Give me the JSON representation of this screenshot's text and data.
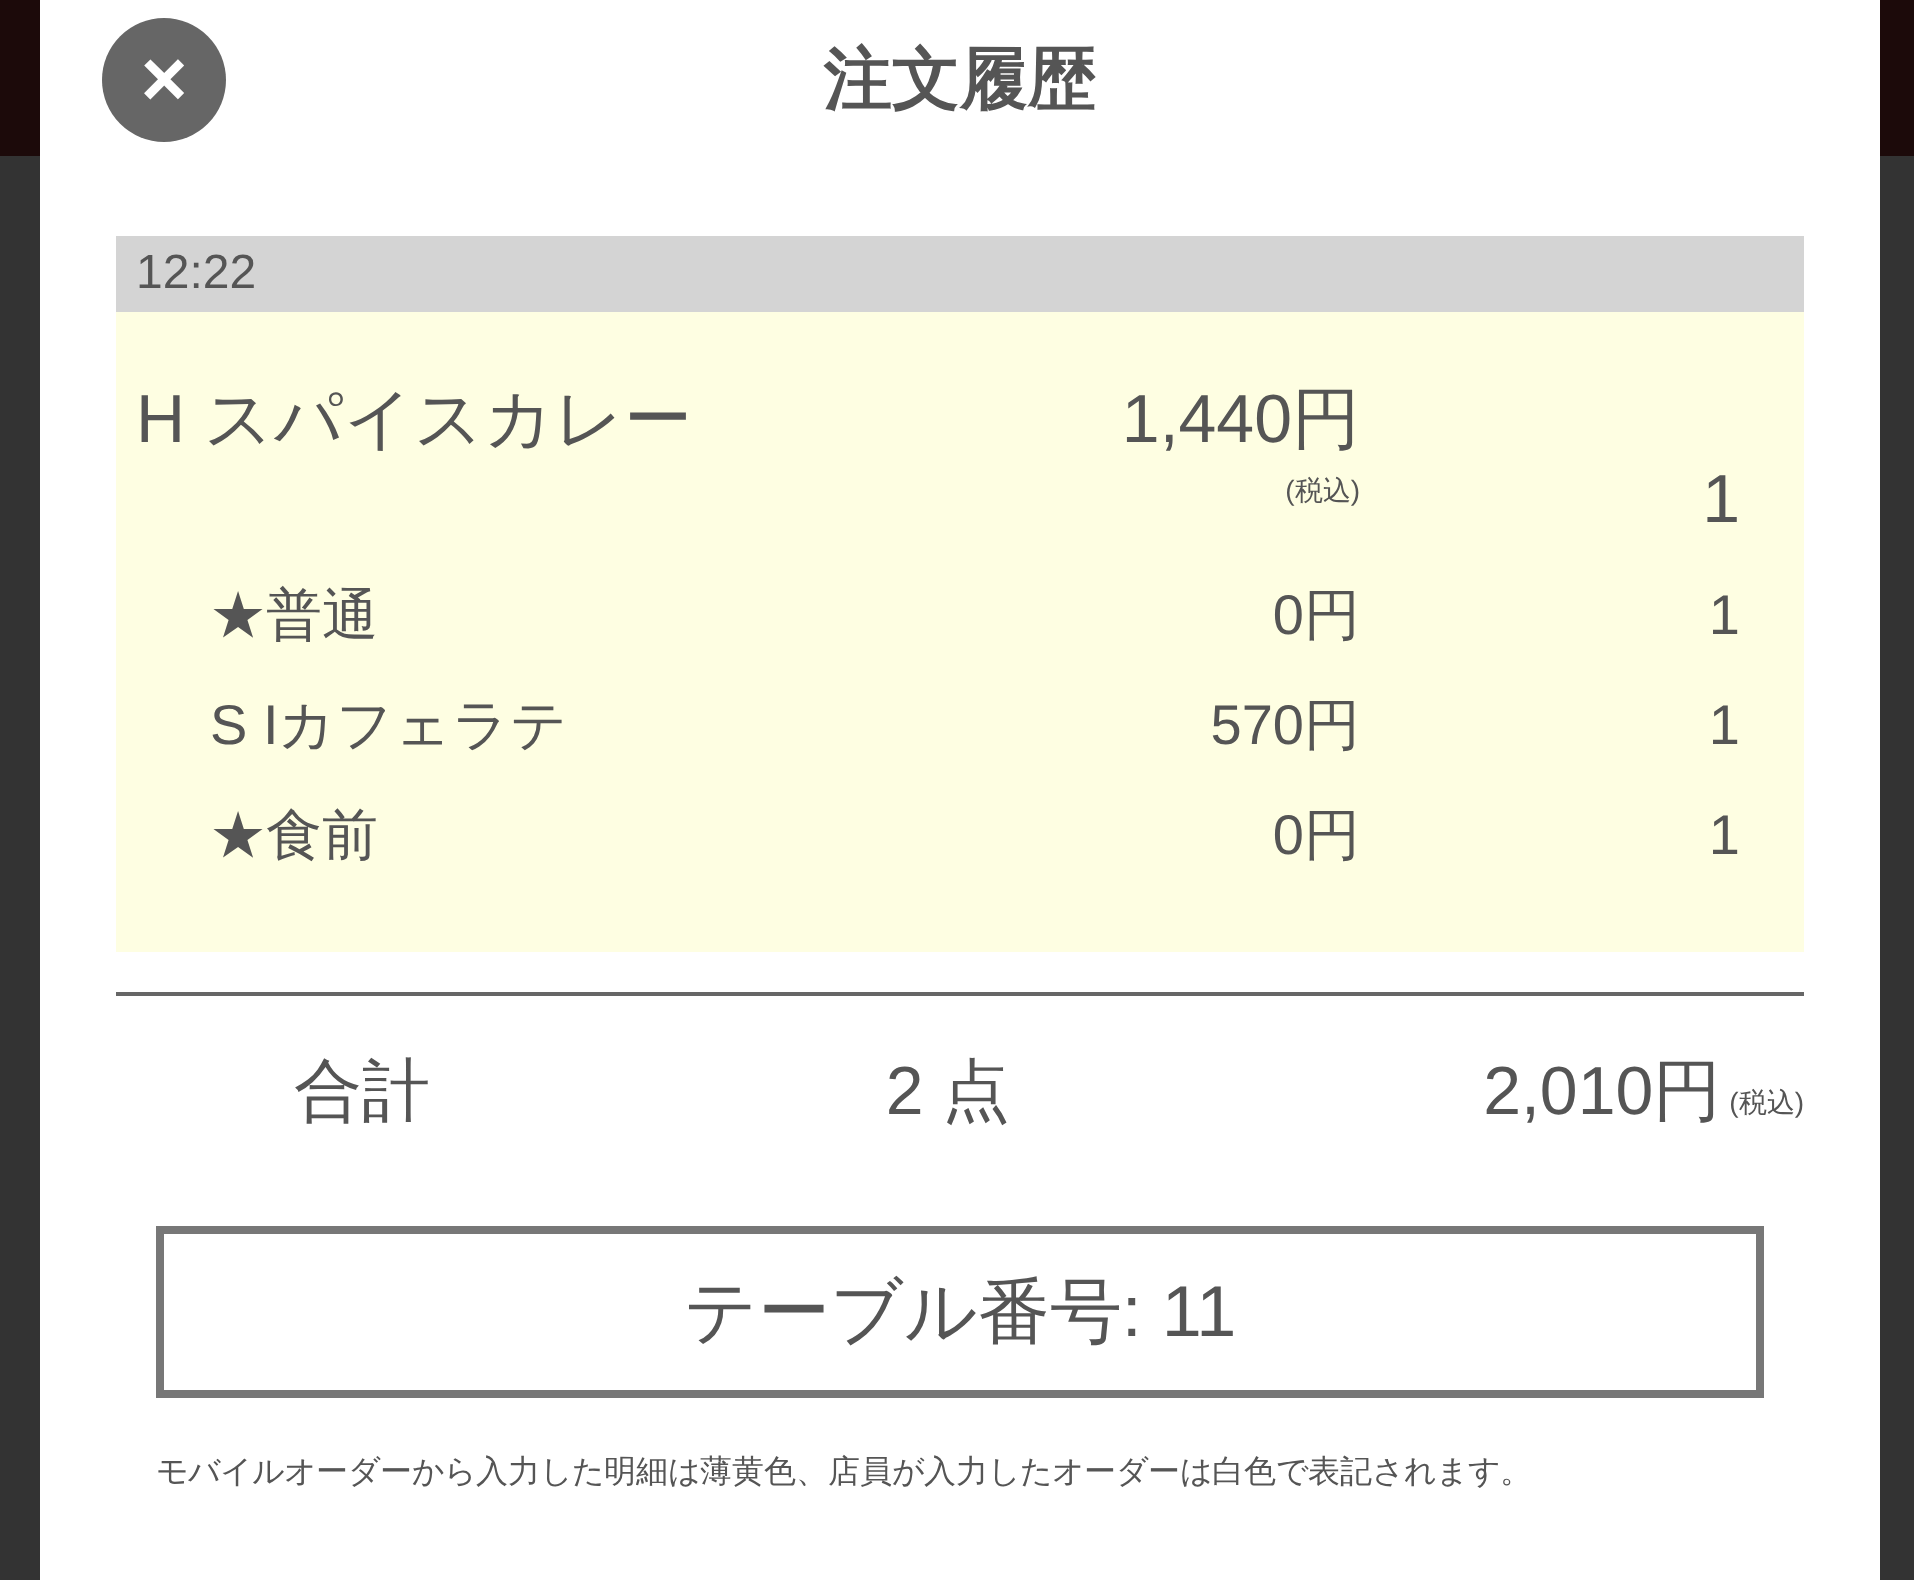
{
  "title": "注文履歴",
  "close": {
    "label": "×"
  },
  "order": {
    "time": "12:22",
    "mobile": true,
    "items": [
      {
        "kind": "main",
        "name": "H スパイスカレー",
        "price": "1,440円",
        "tax": "(税込)",
        "qty": "1"
      },
      {
        "kind": "sub",
        "name": "★普通",
        "price": "0円",
        "qty": "1"
      },
      {
        "kind": "sub",
        "name": "S Iカフェラテ",
        "price": "570円",
        "qty": "1"
      },
      {
        "kind": "sub",
        "name": "★食前",
        "price": "0円",
        "qty": "1"
      }
    ]
  },
  "total": {
    "label": "合計",
    "count": "2 点",
    "amount": "2,010円",
    "tax": "(税込)"
  },
  "table_number": "テーブル番号: 11",
  "note": "モバイルオーダーから入力した明細は薄黄色、店員が入力したオーダーは白色で表記されます。"
}
